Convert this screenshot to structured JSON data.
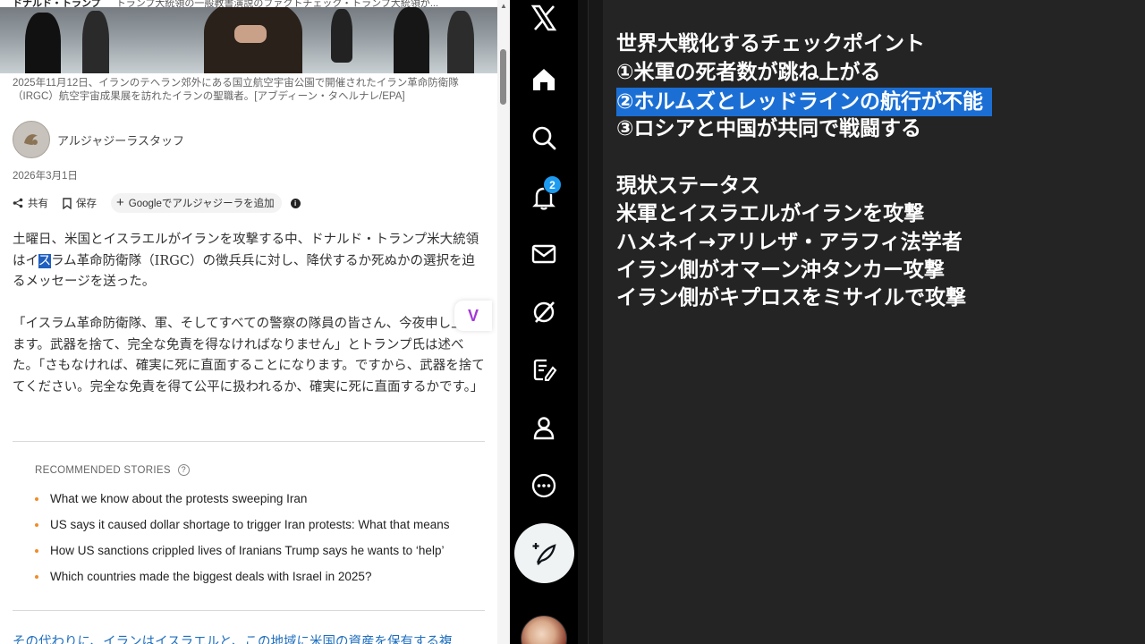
{
  "article": {
    "hero_bar": {
      "left": "ドナルド・トランプ",
      "right": "トランプ大統領の一般教書演説のファクトチェック・トランプ大統領が..."
    },
    "caption": "2025年11月12日、イランのテヘラン郊外にある国立航空宇宙公園で開催されたイラン革命防衛隊（IRGC）航空宇宙成果展を訪れたイランの聖職者。[アブディーン・タヘルナレ/EPA]",
    "author": "アルジャジーラスタッフ",
    "date": "2026年3月1日",
    "actions": {
      "share": "共有",
      "save": "保存",
      "add_google": "Googleでアルジャジーラを追加"
    },
    "p1": {
      "before": "土曜日、米国とイスラエルがイランを攻撃する中、ドナルド・トランプ米大統領はイ",
      "selected": "ス",
      "after": "ラム革命防衛隊（IRGC）の徴兵兵に対し、降伏するか死ぬかの選択を迫るメッセージを送った。"
    },
    "p2": "「イスラム革命防衛隊、軍、そしてすべての警察の隊員の皆さん、今夜申し上げます。武器を捨て、完全な免責を得なければなりません」とトランプ氏は述べた。「さもなければ、確実に死に直面することになります。ですから、武器を捨ててください。完全な免責を得て公平に扱われるか、確実に死に直面するかです。」",
    "recommended": {
      "title": "RECOMMENDED STORIES",
      "items": [
        "What we know about the protests sweeping Iran",
        "US says it caused dollar shortage to trigger Iran protests: What that means",
        "How US sanctions crippled lives of Iranians Trump says he wants to ‘help’",
        "Which countries made the biggest deals with Israel in 2025?"
      ]
    },
    "bottom": "その代わりに、イランはイスラエルと、この地域に米国の資産を保有する複"
  },
  "x_nav": {
    "notification_count": "2",
    "icons": [
      "x-logo-icon",
      "home-icon",
      "search-icon",
      "bell-icon",
      "mail-icon",
      "grok-icon",
      "compose-list-icon",
      "profile-icon",
      "more-icon",
      "post-icon"
    ]
  },
  "notes": {
    "lines": [
      "世界大戦化するチェックポイント",
      "①米軍の死者数が跳ね上がる",
      "②ホルムズとレッドラインの航行が不能",
      "③ロシアと中国が共同で戦闘する",
      "",
      "現状ステータス",
      "米軍とイスラエルがイランを攻撃",
      "ハメネイ→アリレザ・アラフィ法学者",
      "イラン側がオマーン沖タンカー攻撃",
      "イラン側がキプロスをミサイルで攻撃"
    ],
    "highlight_color": "#1b6fd4"
  },
  "colors": {
    "notes_bg": "#242424",
    "x_badge": "#1d9bf0",
    "bullet": "#f08c28"
  }
}
